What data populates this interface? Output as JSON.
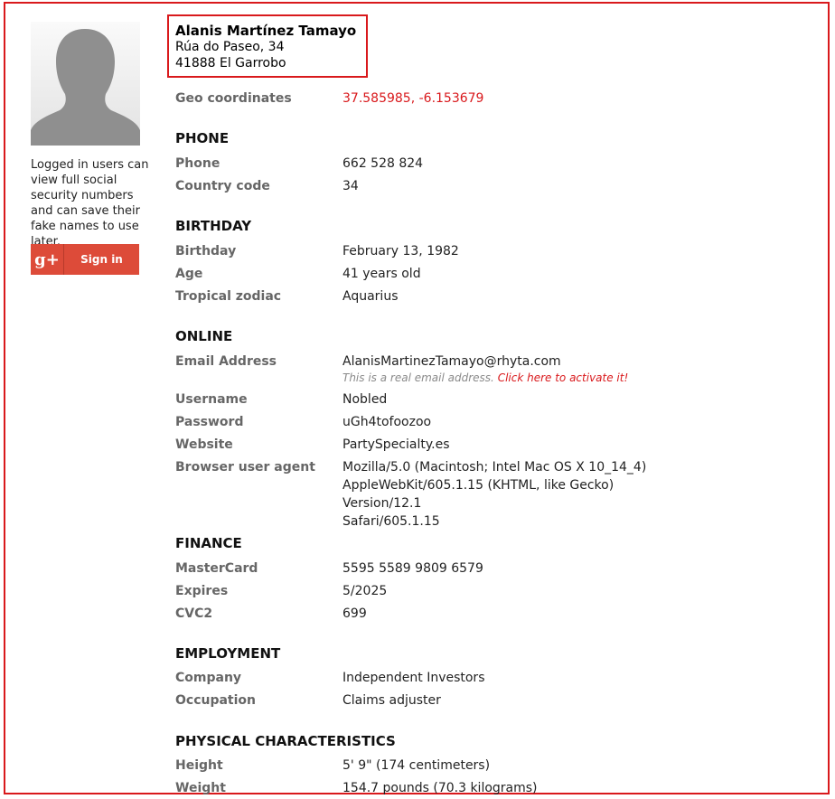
{
  "sidebar": {
    "note": "Logged in users can view full social security numbers and can save their fake names to use later.",
    "google_icon": "g+",
    "signin_label": "Sign in"
  },
  "identity": {
    "name": "Alanis Martínez Tamayo",
    "street": "Rúa do Paseo, 34",
    "city": "41888 El Garrobo"
  },
  "geo": {
    "label": "Geo coordinates",
    "value": "37.585985, -6.153679"
  },
  "phone": {
    "header": "PHONE",
    "phone_label": "Phone",
    "phone_value": "662 528 824",
    "cc_label": "Country code",
    "cc_value": "34"
  },
  "birthday": {
    "header": "BIRTHDAY",
    "bday_label": "Birthday",
    "bday_value": "February 13, 1982",
    "age_label": "Age",
    "age_value": "41 years old",
    "zodiac_label": "Tropical zodiac",
    "zodiac_value": "Aquarius"
  },
  "online": {
    "header": "ONLINE",
    "email_label": "Email Address",
    "email_value": "AlanisMartinezTamayo@rhyta.com",
    "email_note": "This is a real email address.",
    "email_link": "Click here to activate it!",
    "user_label": "Username",
    "user_value": "Nobled",
    "pass_label": "Password",
    "pass_value": "uGh4tofoozoo",
    "web_label": "Website",
    "web_value": "PartySpecialty.es",
    "ua_label": "Browser user agent",
    "ua_line1": "Mozilla/5.0 (Macintosh; Intel Mac OS X 10_14_4)",
    "ua_line2": "AppleWebKit/605.1.15 (KHTML, like Gecko) Version/12.1",
    "ua_line3": "Safari/605.1.15"
  },
  "finance": {
    "header": "FINANCE",
    "card_label": "MasterCard",
    "card_value": "5595 5589 9809 6579",
    "exp_label": "Expires",
    "exp_value": "5/2025",
    "cvc_label": "CVC2",
    "cvc_value": "699"
  },
  "employment": {
    "header": "EMPLOYMENT",
    "company_label": "Company",
    "company_value": "Independent Investors",
    "occ_label": "Occupation",
    "occ_value": "Claims adjuster"
  },
  "physical": {
    "header": "PHYSICAL CHARACTERISTICS",
    "height_label": "Height",
    "height_value": "5' 9\" (174 centimeters)",
    "weight_label": "Weight",
    "weight_value": "154.7 pounds (70.3 kilograms)"
  },
  "colors": {
    "accent_red": "#d9191c",
    "google_red": "#dd4b39",
    "label_gray": "#666666"
  }
}
